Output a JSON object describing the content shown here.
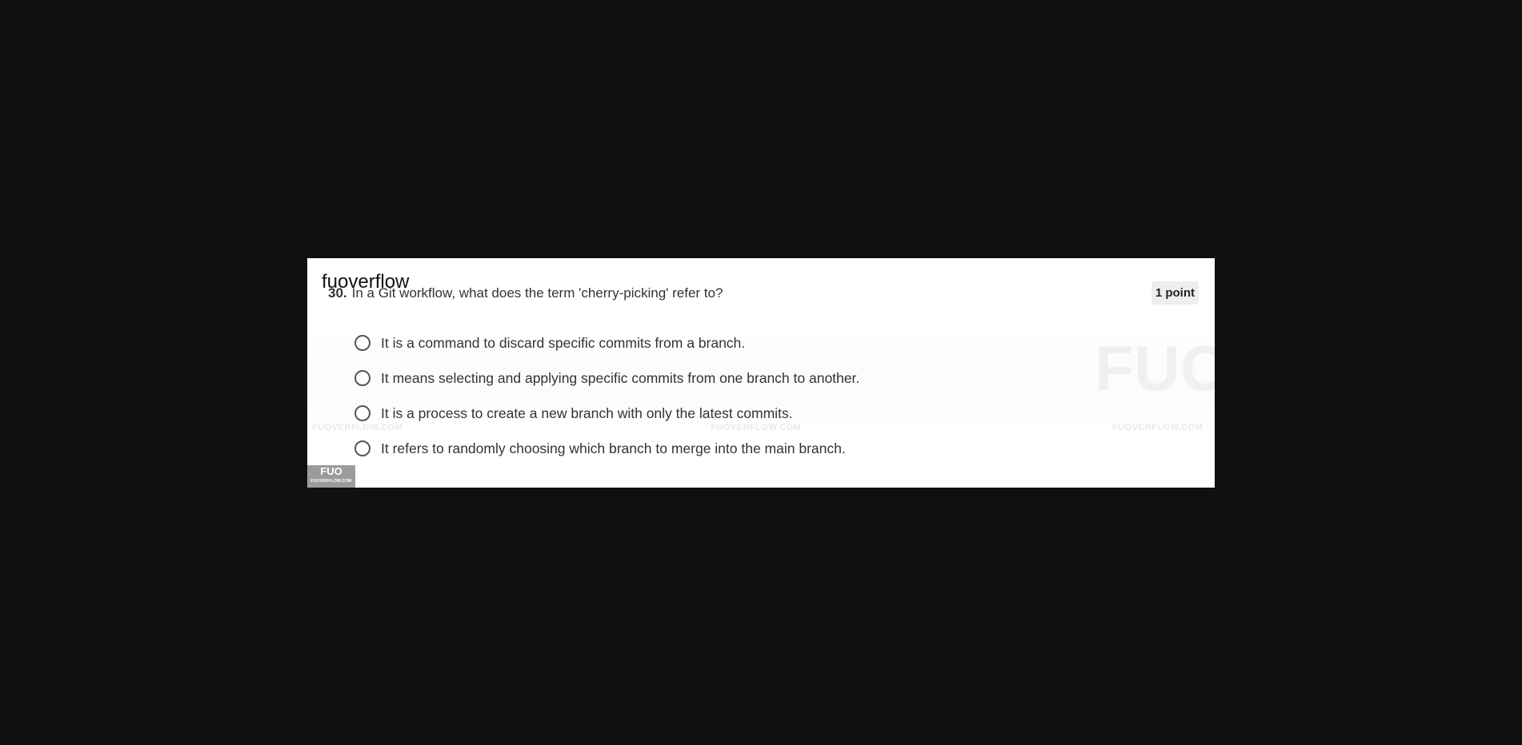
{
  "brand": {
    "name": "fuoverflow"
  },
  "question": {
    "number": "30.",
    "text": "In a Git workflow, what does the term 'cherry-picking' refer to?",
    "points": "1 point"
  },
  "options": [
    {
      "label": "It is a command to discard specific commits from a branch."
    },
    {
      "label": "It means selecting and applying specific commits from one branch to another."
    },
    {
      "label": "It is a process to create a new branch with only the latest commits."
    },
    {
      "label": "It refers to randomly choosing which branch to merge into the main branch."
    }
  ],
  "watermark": {
    "text": "FUOVERFLOW.COM",
    "logo": "FUO"
  },
  "footer_logo": {
    "mark": "FUO",
    "caption": "FUOVERFLOW.COM"
  },
  "colors": {
    "background": "#101010",
    "card": "#ffffff",
    "badge": "#eeeeee",
    "footer_logo": "#9b9b9b"
  }
}
